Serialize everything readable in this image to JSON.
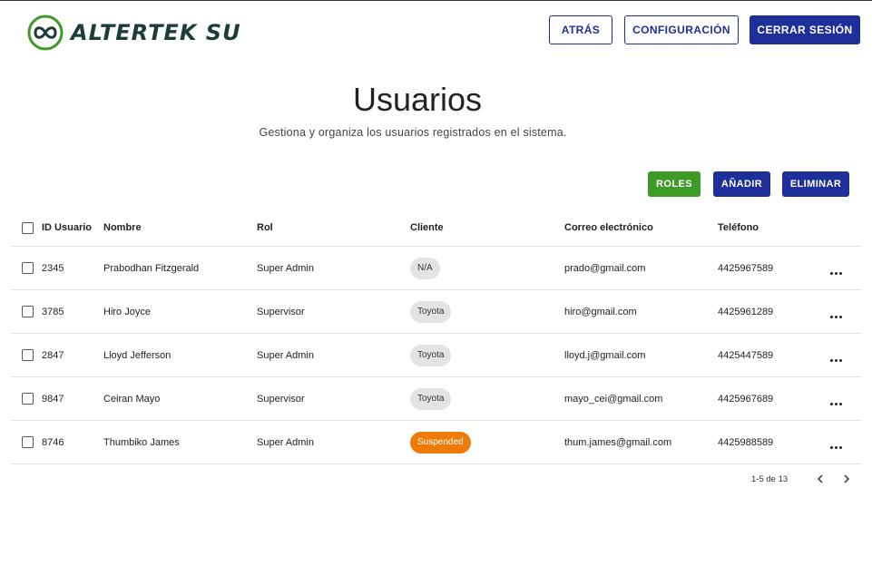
{
  "header": {
    "logo_text": "ALTERTEK SU",
    "back_label": "ATRÁS",
    "config_label": "CONFIGURACIÓN",
    "logout_label": "CERRAR SESIÓN"
  },
  "page": {
    "title": "Usuarios",
    "subtitle": "Gestiona y organiza los usuarios registrados en el sistema."
  },
  "actions": {
    "roles_label": "ROLES",
    "add_label": "AÑADIR",
    "delete_label": "ELIMINAR"
  },
  "table": {
    "columns": [
      "ID Usuario",
      "Nombre",
      "Rol",
      "Cliente",
      "Correo electrónico",
      "Teléfono"
    ],
    "rows": [
      {
        "id": "2345",
        "name": "Prabodhan Fitzgerald",
        "rol": "Super Admin",
        "client": "N/A",
        "email": "prado@gmail.com",
        "phone": "4425967589"
      },
      {
        "id": "3785",
        "name": "Hiro Joyce",
        "rol": "Supervisor",
        "client": "Toyota",
        "email": "hiro@gmail.com",
        "phone": "4425961289"
      },
      {
        "id": "2847",
        "name": "Lloyd Jefferson",
        "rol": "Super Admin",
        "client": "Toyota",
        "email": "lloyd.j@gmail.com",
        "phone": "4425447589"
      },
      {
        "id": "9847",
        "name": "Ceiran Mayo",
        "rol": "Supervisor",
        "client": "Toyota",
        "email": "mayo_cei@gmail.com",
        "phone": "4425967689"
      },
      {
        "id": "8746",
        "name": "Thumbiko James",
        "rol": "Super Admin",
        "client": "Suspended",
        "email": "thum.james@gmail.com",
        "phone": "4425988589"
      }
    ]
  },
  "pagination": {
    "range_text": "1-5 de 13"
  },
  "colors": {
    "primary": "#1f2f9a",
    "success": "#3d9a26",
    "suspended": "#ee7a0a",
    "logo_green": "#3d9a26"
  }
}
